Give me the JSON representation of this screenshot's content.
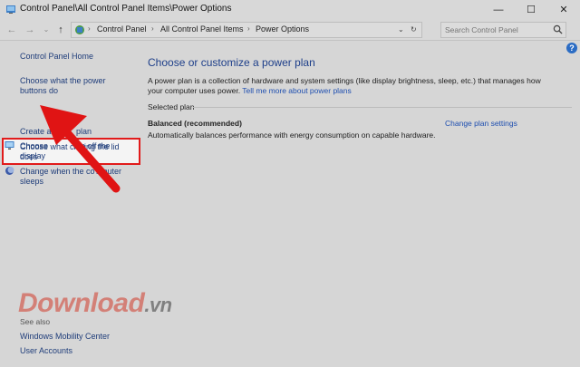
{
  "window": {
    "title": "Control Panel\\All Control Panel Items\\Power Options",
    "minimize_glyph": "—",
    "maximize_glyph": "☐",
    "close_glyph": "✕"
  },
  "address": {
    "crumbs": [
      "Control Panel",
      "All Control Panel Items",
      "Power Options"
    ],
    "search_placeholder": "Search Control Panel"
  },
  "sidebar": {
    "home": "Control Panel Home",
    "links": [
      {
        "line1": "Choose what the power",
        "line2": "buttons do"
      },
      {
        "line1": "Choose what closing the lid",
        "line2": "does"
      },
      {
        "line1": "Create a",
        "line2": "plan"
      },
      {
        "line1": "Choose",
        "line2": "urn off the"
      },
      {
        "line3": "display"
      },
      {
        "line1": "Change when the co",
        "line2": "mputer"
      },
      {
        "line3": "sleeps"
      }
    ],
    "see_also": "See also",
    "see_also_items": [
      "Windows Mobility Center",
      "User Accounts"
    ]
  },
  "main": {
    "heading": "Choose or customize a power plan",
    "desc": "A power plan is a collection of hardware and system settings (like display brightness, sleep, etc.) that manages how your computer uses power.",
    "desc_link": "Tell me more about power plans",
    "selected_label": "Selected plan",
    "plan_name": "Balanced (recommended)",
    "plan_change": "Change plan settings",
    "plan_desc": "Automatically balances performance with energy consumption on capable hardware."
  },
  "watermark": {
    "text": "Download",
    "suffix": ".vn"
  },
  "colors": {
    "highlight_border": "#e11b1b",
    "arrow": "#e01414",
    "link": "#1f3d7a"
  }
}
